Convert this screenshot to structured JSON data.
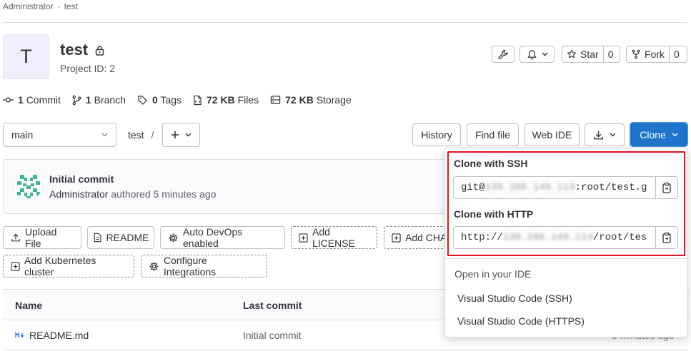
{
  "breadcrumb": {
    "items": [
      "Administrator",
      "test"
    ]
  },
  "project": {
    "avatar_letter": "T",
    "name": "test",
    "id_text": "Project ID: 2"
  },
  "header_actions": {
    "star_label": "Star",
    "star_count": "0",
    "fork_label": "Fork",
    "fork_count": "0"
  },
  "stats": [
    {
      "icon": "commit-icon",
      "value": "1",
      "label": "Commit"
    },
    {
      "icon": "branch-icon",
      "value": "1",
      "label": "Branch"
    },
    {
      "icon": "tag-icon",
      "value": "0",
      "label": "Tags"
    },
    {
      "icon": "file-icon",
      "value": "72 KB",
      "label": "Files"
    },
    {
      "icon": "storage-icon",
      "value": "72 KB",
      "label": "Storage"
    }
  ],
  "toolbar": {
    "branch": "main",
    "path": "test",
    "path_sep": "/",
    "history": "History",
    "find_file": "Find file",
    "web_ide": "Web IDE",
    "clone": "Clone"
  },
  "last_commit": {
    "title": "Initial commit",
    "author": "Administrator",
    "action": "authored",
    "time": "5 minutes ago"
  },
  "quick_actions": {
    "upload": "Upload File",
    "readme": "README",
    "autodevops": "Auto DevOps enabled",
    "license": "Add LICENSE",
    "changelog": "Add CHA",
    "kubernetes": "Add Kubernetes cluster",
    "integrations": "Configure Integrations"
  },
  "file_table": {
    "columns": [
      "Name",
      "Last commit"
    ],
    "rows": [
      {
        "name": "README.md",
        "last_commit": "Initial commit",
        "time": "5 minutes ago"
      }
    ]
  },
  "clone_dropdown": {
    "ssh_label": "Clone with SSH",
    "ssh_prefix": "git@",
    "ssh_host": "139.186.149.113",
    "ssh_suffix": ":root/test.g",
    "http_label": "Clone with HTTP",
    "http_prefix": "http://",
    "http_host": "139.186.149.113",
    "http_suffix": "/root/tes",
    "ide_label": "Open in your IDE",
    "ide_ssh": "Visual Studio Code (SSH)",
    "ide_https": "Visual Studio Code (HTTPS)"
  },
  "colors": {
    "primary": "#1f75cb",
    "primary_border": "#1068bf",
    "highlight": "#e3121b",
    "identicon": "#3fb68b"
  }
}
